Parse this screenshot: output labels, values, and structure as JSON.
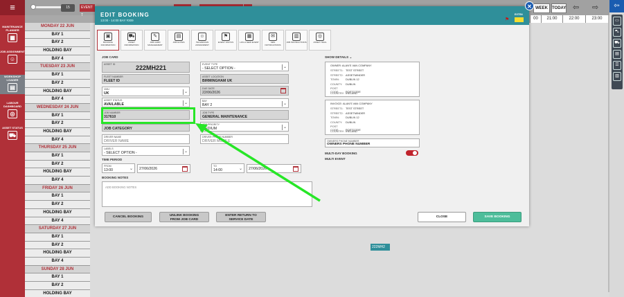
{
  "rail": {
    "items": [
      {
        "label": "MAINTENANCE PLANNER",
        "icon": "planner-icon"
      },
      {
        "label": "JOB ASSIGNMENT",
        "icon": "job-assignment-icon"
      },
      {
        "label": "WORKSHOP LOADER",
        "icon": "workshop-loader-icon"
      },
      {
        "label": "LABOUR DASHBOARD",
        "icon": "labour-dashboard-icon"
      },
      {
        "label": "ASSET STATUS",
        "icon": "asset-status-icon"
      }
    ]
  },
  "topbar": {
    "zoom_value": "15",
    "event_label": "EVENT T",
    "week_label": "WEEK",
    "today_label": "TODAY"
  },
  "timeline": {
    "hours": [
      "00",
      "21:00",
      "22:00",
      "23:00"
    ]
  },
  "schedule_rows": [
    {
      "label": "MONDAY 22 JUN",
      "type": "day"
    },
    {
      "label": "BAY 1",
      "type": "bay"
    },
    {
      "label": "BAY 2",
      "type": "bay"
    },
    {
      "label": "HOLDING BAY",
      "type": "bay"
    },
    {
      "label": "BAY 4",
      "type": "bay"
    },
    {
      "label": "TUESDAY 23 JUN",
      "type": "day"
    },
    {
      "label": "BAY 1",
      "type": "bay"
    },
    {
      "label": "BAY 2",
      "type": "bay"
    },
    {
      "label": "HOLDING BAY",
      "type": "bay"
    },
    {
      "label": "BAY 4",
      "type": "bay"
    },
    {
      "label": "WEDNESDAY 24 JUN",
      "type": "day"
    },
    {
      "label": "BAY 1",
      "type": "bay"
    },
    {
      "label": "BAY 2",
      "type": "bay"
    },
    {
      "label": "HOLDING BAY",
      "type": "bay"
    },
    {
      "label": "BAY 4",
      "type": "bay"
    },
    {
      "label": "THURSDAY 25 JUN",
      "type": "day"
    },
    {
      "label": "BAY 1",
      "type": "bay"
    },
    {
      "label": "BAY 2",
      "type": "bay"
    },
    {
      "label": "HOLDING BAY",
      "type": "bay"
    },
    {
      "label": "BAY 4",
      "type": "bay"
    },
    {
      "label": "FRIDAY 26 JUN",
      "type": "day"
    },
    {
      "label": "BAY 1",
      "type": "bay"
    },
    {
      "label": "BAY 2",
      "type": "bay"
    },
    {
      "label": "HOLDING BAY",
      "type": "bay"
    },
    {
      "label": "BAY 4",
      "type": "bay"
    },
    {
      "label": "SATURDAY 27 JUN",
      "type": "day"
    },
    {
      "label": "BAY 1",
      "type": "bay"
    },
    {
      "label": "BAY 2",
      "type": "bay"
    },
    {
      "label": "HOLDING BAY",
      "type": "bay"
    },
    {
      "label": "BAY 4",
      "type": "bay"
    },
    {
      "label": "SUNDAY 28 JUN",
      "type": "day"
    },
    {
      "label": "BAY 1",
      "type": "bay"
    },
    {
      "label": "BAY 2",
      "type": "bay"
    },
    {
      "label": "HOLDING BAY",
      "type": "bay"
    }
  ],
  "booking_chip": "222MH2",
  "modal": {
    "title": "EDIT BOOKING",
    "subtitle": "13:00 - 14:00   BAY #309",
    "eta_label": "EXTEN",
    "toolbar": [
      {
        "label": "BOOKING INFORMATION",
        "icon": "booking-info-icon",
        "active": true
      },
      {
        "label": "ASSET INFORMATION",
        "icon": "asset-info-icon"
      },
      {
        "label": "JOB CARD MANAGEMENT",
        "icon": "job-card-icon"
      },
      {
        "label": "JOB NOTES",
        "icon": "job-notes-icon"
      },
      {
        "label": "TECHNICIAN ASSIGNMENT",
        "icon": "technician-icon"
      },
      {
        "label": "EVENT STATUS",
        "icon": "event-status-icon"
      },
      {
        "label": "LOG A NEW EVENT",
        "icon": "new-event-icon"
      },
      {
        "label": "SMS NOTIFICATIONS",
        "icon": "sms-icon"
      },
      {
        "label": "JOB INSTRUCTIONS",
        "icon": "instructions-icon"
      },
      {
        "label": "ASSET TRAIL",
        "icon": "asset-trail-icon"
      }
    ],
    "job_card_heading": "JOB CARD",
    "asset_id": {
      "label": "ASSET ID",
      "value": "222MH221"
    },
    "fleet_number": {
      "label": "FLEET NUMBER",
      "value": "FLEET ID"
    },
    "vmu": {
      "label": "VMU",
      "value": "UK"
    },
    "asset_status": {
      "label": "ASSET STATUS",
      "value": "AVAILABLE"
    },
    "job_number": {
      "label": "JOB NUMBER",
      "value": "317610"
    },
    "job_category": {
      "label": "",
      "value": "JOB CATEGORY"
    },
    "driver_name": {
      "label": "DRIVER NAME",
      "placeholder": "DRIVER NAME"
    },
    "labels": {
      "label": "LABELS",
      "value": "- SELECT OPTION -"
    },
    "event_type": {
      "label": "EVENT TYPE",
      "value": "- SELECT OPTION -"
    },
    "asset_location": {
      "label": "ASSET LOCATION",
      "value": "BIRMINGHAM UK"
    },
    "due_date": {
      "label": "DUE DATE",
      "value": "22/06/2026"
    },
    "bay": {
      "label": "BAY",
      "value": "BAY 2"
    },
    "job_type": {
      "label": "JOB TYPE",
      "value": "GENERAL MAINTENANCE"
    },
    "job_priority": {
      "label": "JOB PRIORITY",
      "value": "MEDIUM"
    },
    "driver_phone": {
      "label": "DRIVER PHONE NUMBER",
      "placeholder": "DRIVER MOBILE"
    },
    "time_period_heading": "TIME PERIOD",
    "from": {
      "label": "FROM",
      "time": "13:00",
      "date": "27/06/2026"
    },
    "to": {
      "label": "TO",
      "time": "14:00",
      "date": "27/06/2026"
    },
    "booking_notes_heading": "BOOKING NOTES",
    "booking_notes_placeholder": "ADD BOOKING NOTES",
    "show_details_heading": "SHOW DETAILS",
    "owner_address": {
      "title": "OWNER: ALAN'S VAN COMPANY",
      "lines": [
        {
          "k": "STREET1:",
          "v": "TEST STREET"
        },
        {
          "k": "STREET2:",
          "v": "ASSETMINDER"
        },
        {
          "k": "TOWN:",
          "v": "DUBLIN 12"
        },
        {
          "k": "COUNTY:",
          "v": "DUBLIN"
        },
        {
          "k": "POST CODE:",
          "v": "POSTCODE"
        },
        {
          "k": "COUNTRY:",
          "v": "IRELAND"
        }
      ]
    },
    "invoice_address": {
      "title": "INVOICE: ALAN'S VAN COMPANY",
      "lines": [
        {
          "k": "STREET1:",
          "v": "TEST STREET"
        },
        {
          "k": "STREET2:",
          "v": "ASSETMINDER"
        },
        {
          "k": "TOWN:",
          "v": "DUBLIN 12"
        },
        {
          "k": "COUNTY:",
          "v": "DUBLIN"
        },
        {
          "k": "POST CODE:",
          "v": "POSTCODE"
        },
        {
          "k": "COUNTRY:",
          "v": "IRELAND"
        }
      ]
    },
    "owners_phone": {
      "label": "OWNERS PHONE NUMBER",
      "value": "OWNERS PHONE NUMBER"
    },
    "multi_day_label": "MULTI-DAY BOOKING",
    "multi_event_label": "MULTI EVENT",
    "buttons": {
      "cancel": "CANCEL BOOKING",
      "unlink_1": "UNLINK BOOKING",
      "unlink_2": "FROM JOB CARD",
      "return_1": "ENTER RETURN TO",
      "return_2": "SERVICE DATE",
      "close": "CLOSE",
      "save": "SAVE BOOKING"
    }
  },
  "colors": {
    "accent": "#2f8f9a",
    "brand_red": "#b03038",
    "highlight": "#27e627",
    "save": "#4dbd9a"
  }
}
